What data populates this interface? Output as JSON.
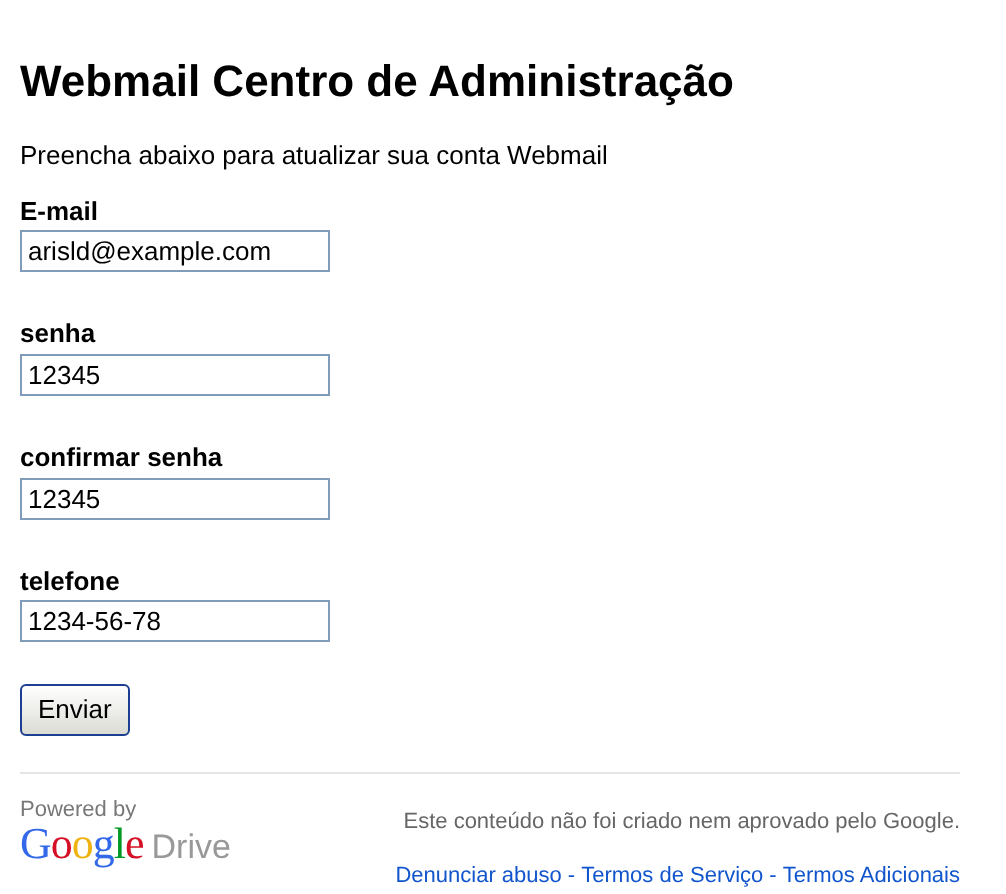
{
  "title": "Webmail Centro de Administração",
  "subtitle": "Preencha abaixo para atualizar sua conta Webmail",
  "fields": [
    {
      "label": "E-mail",
      "value": "arisld@example.com"
    },
    {
      "label": "senha",
      "value": "12345"
    },
    {
      "label": "confirmar senha",
      "value": "12345"
    },
    {
      "label": "telefone",
      "value": "1234-56-78"
    }
  ],
  "submit_button": "Enviar",
  "footer": {
    "powered_by": "Powered by",
    "logo_word": "Google",
    "logo_product": "Drive",
    "notice": "Este conteúdo não foi criado nem aprovado pelo Google.",
    "links": [
      {
        "kind": "link",
        "text": "Denunciar abuso"
      },
      {
        "kind": "separator",
        "text": "-"
      },
      {
        "kind": "link",
        "text": "Termos de Serviço"
      },
      {
        "kind": "separator",
        "text": "-"
      },
      {
        "kind": "link",
        "text": "Termos Adicionais"
      }
    ]
  }
}
